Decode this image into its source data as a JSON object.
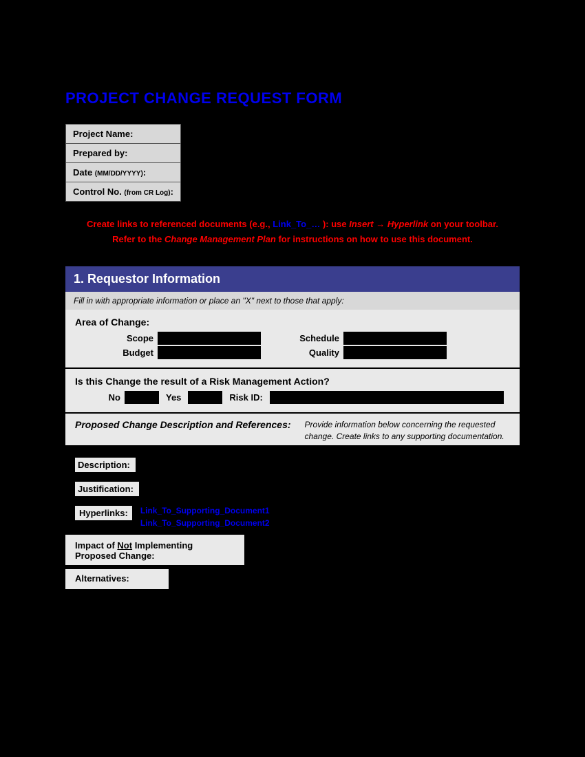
{
  "title": "PROJECT CHANGE REQUEST FORM",
  "meta": {
    "project_name_label": "Project Name:",
    "prepared_by_label": "Prepared by:",
    "date_label_prefix": "Date ",
    "date_label_sub": "(MM/DD/YYYY)",
    "date_label_suffix": ":",
    "control_label_prefix": "Control No. ",
    "control_label_sub": "(from CR Log)",
    "control_label_suffix": ":"
  },
  "instructions": {
    "line1_a": "Create links to referenced documents (e.g., ",
    "line1_link": "Link_To_…",
    "line1_b": " ): use ",
    "line1_insert": "Insert",
    "line1_arrow": "→",
    "line1_hyperlink": "Hyperlink",
    "line1_c": " on your toolbar.",
    "line2_a": "Refer to the ",
    "line2_plan": "Change Management Plan",
    "line2_b": " for instructions on how to use this document."
  },
  "section": {
    "number_title": "1.  Requestor Information",
    "subtitle": "Fill in with appropriate information or place an \"X\" next to those that apply:",
    "area_of_change": "Area of Change:",
    "scope": "Scope",
    "schedule": "Schedule",
    "budget": "Budget",
    "quality": "Quality",
    "risk_question": "Is this Change the result of a Risk Management Action?",
    "no": "No",
    "yes": "Yes",
    "risk_id": "Risk ID:",
    "proposed_heading": "Proposed Change Description and References:",
    "proposed_help": "Provide information below concerning the requested change. Create links to any supporting documentation.",
    "description_label": "Description:",
    "justification_label": "Justification:",
    "hyperlinks_label": "Hyperlinks:",
    "hyperlink1": "Link_To_Supporting_Document1",
    "hyperlink2": "Link_To_Supporting_Document2",
    "impact_prefix": "Impact of ",
    "impact_not": "Not",
    "impact_suffix": " Implementing Proposed Change:",
    "alternatives_label": "Alternatives:"
  }
}
